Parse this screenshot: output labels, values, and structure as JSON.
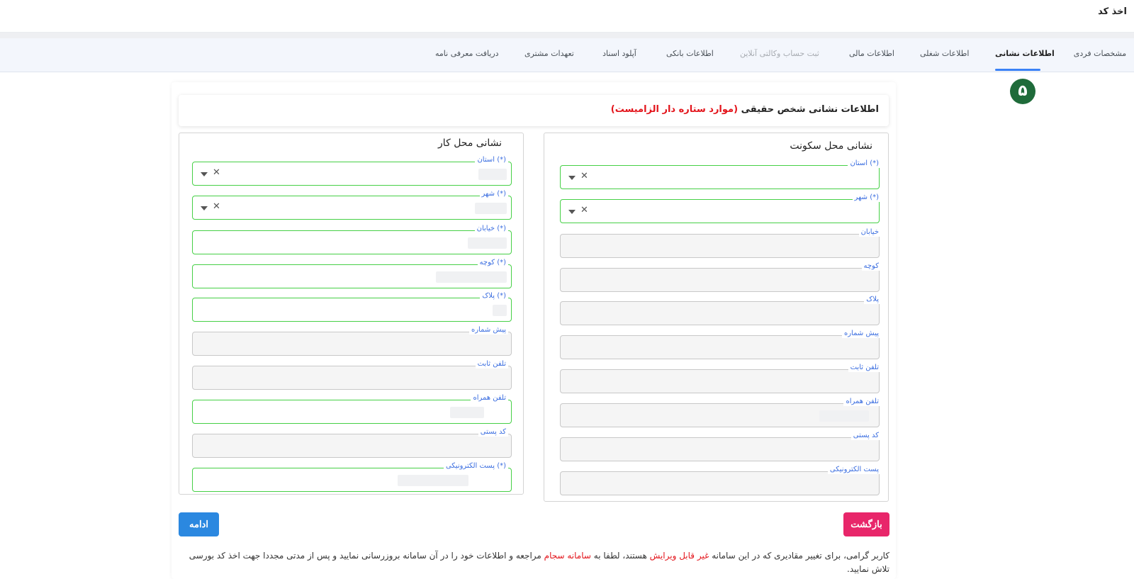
{
  "app": {
    "title": "اخذ کد"
  },
  "tabs": [
    {
      "label": "مشخصات فردی",
      "state": "normal"
    },
    {
      "label": "اطلاعات نشانی",
      "state": "active"
    },
    {
      "label": "اطلاعات شغلی",
      "state": "normal"
    },
    {
      "label": "اطلاعات مالی",
      "state": "normal"
    },
    {
      "label": "ثبت حساب وکالتی آنلاین",
      "state": "disabled"
    },
    {
      "label": "اطلاعات بانکی",
      "state": "normal"
    },
    {
      "label": "آپلود اسناد",
      "state": "normal"
    },
    {
      "label": "تعهدات مشتری",
      "state": "normal"
    },
    {
      "label": "دریافت معرفی نامه",
      "state": "normal"
    }
  ],
  "step": {
    "number": "۵"
  },
  "form": {
    "title": "اطلاعات نشانی شخص حقیقی",
    "required_note": "(موارد ستاره دار الزامیست)"
  },
  "residence": {
    "title": "نشانی محل سکونت",
    "province_label": "استان (*)",
    "city_label": "شهر (*)",
    "street_label": "خیابان",
    "alley_label": "کوچه",
    "plaque_label": "پلاک",
    "area_code_label": "پیش شماره",
    "phone_label": "تلفن ثابت",
    "mobile_label": "تلفن همراه",
    "postal_code_label": "کد پستی",
    "email_label": "پست الکترونیکی"
  },
  "work": {
    "title": "نشانی محل کار",
    "province_label": "استان (*)",
    "city_label": "شهر (*)",
    "street_label": "خیابان (*)",
    "alley_label": "کوچه (*)",
    "plaque_label": "پلاک (*)",
    "area_code_label": "پیش شماره",
    "phone_label": "تلفن ثابت",
    "mobile_label": "تلفن همراه",
    "postal_code_label": "کد پستی",
    "email_label": "پست الکترونیکی (*)"
  },
  "buttons": {
    "back": "بازگشت",
    "next": "ادامه"
  },
  "notice": {
    "part1": "کاربر گرامی، برای تغییر مقادیری که در این سامانه ",
    "highlight1": "غیر قابل ویرایش",
    "part2": " هستند، لطفا به ",
    "highlight2": "سامانه سجام",
    "part3": " مراجعه و اطلاعات خود را در آن سامانه بروزرسانی نمایید و پس از مدتی مجددا جهت اخذ کد بورسی تلاش نمایید."
  },
  "colors": {
    "active_tab_underline": "#3b82f6",
    "required_border": "#46d046",
    "label_blue": "#3b6ee0",
    "back_button": "#e8266a",
    "next_button": "#2b88e0",
    "step_badge": "#1f6b3a",
    "required_note": "#e3141b"
  }
}
